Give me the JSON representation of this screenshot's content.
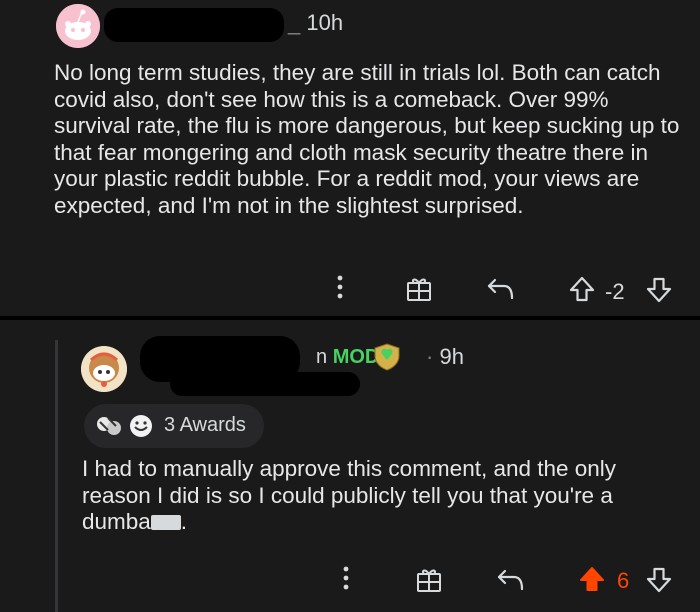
{
  "comment": {
    "time": "10h",
    "body": "No long term studies, they are still in trials lol. Both can catch covid also, don't see how this is a comeback. Over 99% survival rate, the flu is more dangerous, but keep sucking up to that fear mongering and cloth mask security theatre there in your plastic reddit bubble. For a reddit mod, your views are expected, and I'm not in the slightest surprised.",
    "score": "-2",
    "icons": [
      "more-options-icon",
      "gift-icon",
      "reply-icon",
      "upvote-icon",
      "downvote-icon"
    ]
  },
  "reply": {
    "username_fragment": "n",
    "flair": "MOD",
    "time": "9h",
    "awards_label": "3 Awards",
    "body_text": "I had to manually approve this comment, and the only reason I did is so I could publicly tell you that you're a dumba",
    "body_end": ".",
    "score": "6",
    "upvoted": true,
    "colors": {
      "mod": "#46d160",
      "upvote_active": "#ff4500",
      "background": "#1a1a1b"
    }
  }
}
